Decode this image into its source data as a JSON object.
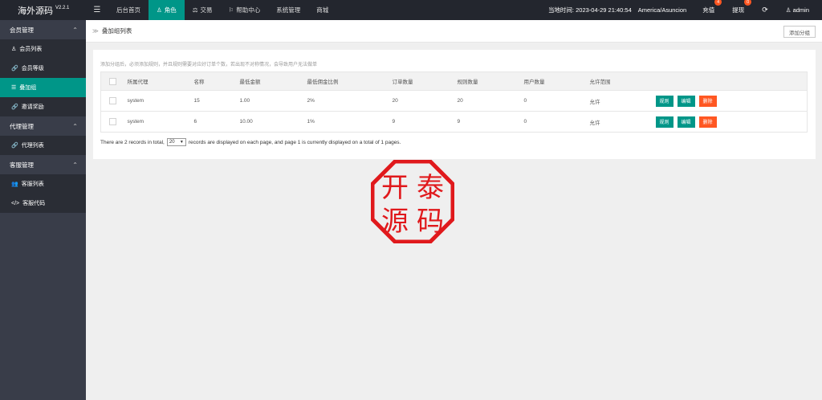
{
  "header": {
    "app_name": "海外源码",
    "version": "V2.2.1",
    "menu_toggle_icon": "menu-icon",
    "nav": [
      {
        "label": "后台首页",
        "icon": ""
      },
      {
        "label": "角色",
        "icon": "user-icon"
      },
      {
        "label": "交易",
        "icon": "scale-icon"
      },
      {
        "label": "帮助中心",
        "icon": "flag-icon"
      },
      {
        "label": "系统管理",
        "icon": ""
      },
      {
        "label": "商城",
        "icon": ""
      }
    ],
    "active_nav": "角色",
    "time_label": "当地时间: 2023-04-29 21:40:54",
    "timezone": "America/Asuncion",
    "recharge_label": "充值",
    "recharge_count": "4",
    "withdraw_label": "提现",
    "withdraw_count": "0",
    "user": "admin"
  },
  "sidebar": {
    "groups": [
      {
        "label": "会员管理",
        "items": [
          {
            "label": "会员列表",
            "icon": "user-icon"
          },
          {
            "label": "会员等级",
            "icon": "link-icon"
          },
          {
            "label": "叠加组",
            "icon": "list-icon",
            "active": true
          },
          {
            "label": "邀请奖励",
            "icon": "link-icon"
          }
        ]
      },
      {
        "label": "代理管理",
        "items": [
          {
            "label": "代理列表",
            "icon": "link-icon"
          }
        ]
      },
      {
        "label": "客服管理",
        "items": [
          {
            "label": "客服列表",
            "icon": "users-icon"
          },
          {
            "label": "客服代码",
            "icon": "code-icon"
          }
        ]
      }
    ]
  },
  "breadcrumb": {
    "title": "叠加组列表",
    "add_button": "添加分组"
  },
  "main": {
    "hint": "添加分组后，必须添加规则，并且规则需要对应好订单个数，若出现不对称情况，会导致用户无法做单",
    "columns": [
      "所属代理",
      "名称",
      "最低金额",
      "最低佣金比例",
      "订单数量",
      "规则数量",
      "用户数量",
      "允许范围"
    ],
    "rows": [
      {
        "agent": "system",
        "name": "15",
        "min_amount": "1.00",
        "min_commission": "2%",
        "orders": "20",
        "rules": "20",
        "users": "0",
        "scope": "允许"
      },
      {
        "agent": "system",
        "name": "6",
        "min_amount": "10.00",
        "min_commission": "1%",
        "orders": "9",
        "rules": "9",
        "users": "0",
        "scope": "允许"
      }
    ],
    "row_actions": {
      "rules": "规则",
      "edit": "编辑",
      "delete": "删除"
    },
    "pager": {
      "prefix": "There are 2 records in total,",
      "page_size": "20",
      "suffix": "records are displayed on each page, and page 1 is currently displayed on a total of 1 pages."
    }
  },
  "watermark": {
    "chars": [
      "开",
      "泰",
      "源",
      "码"
    ]
  },
  "colors": {
    "accent": "#009688",
    "danger": "#ff5722",
    "header_bg": "#23262e",
    "sidebar_bg": "#393d49",
    "seal": "#e0191c"
  }
}
